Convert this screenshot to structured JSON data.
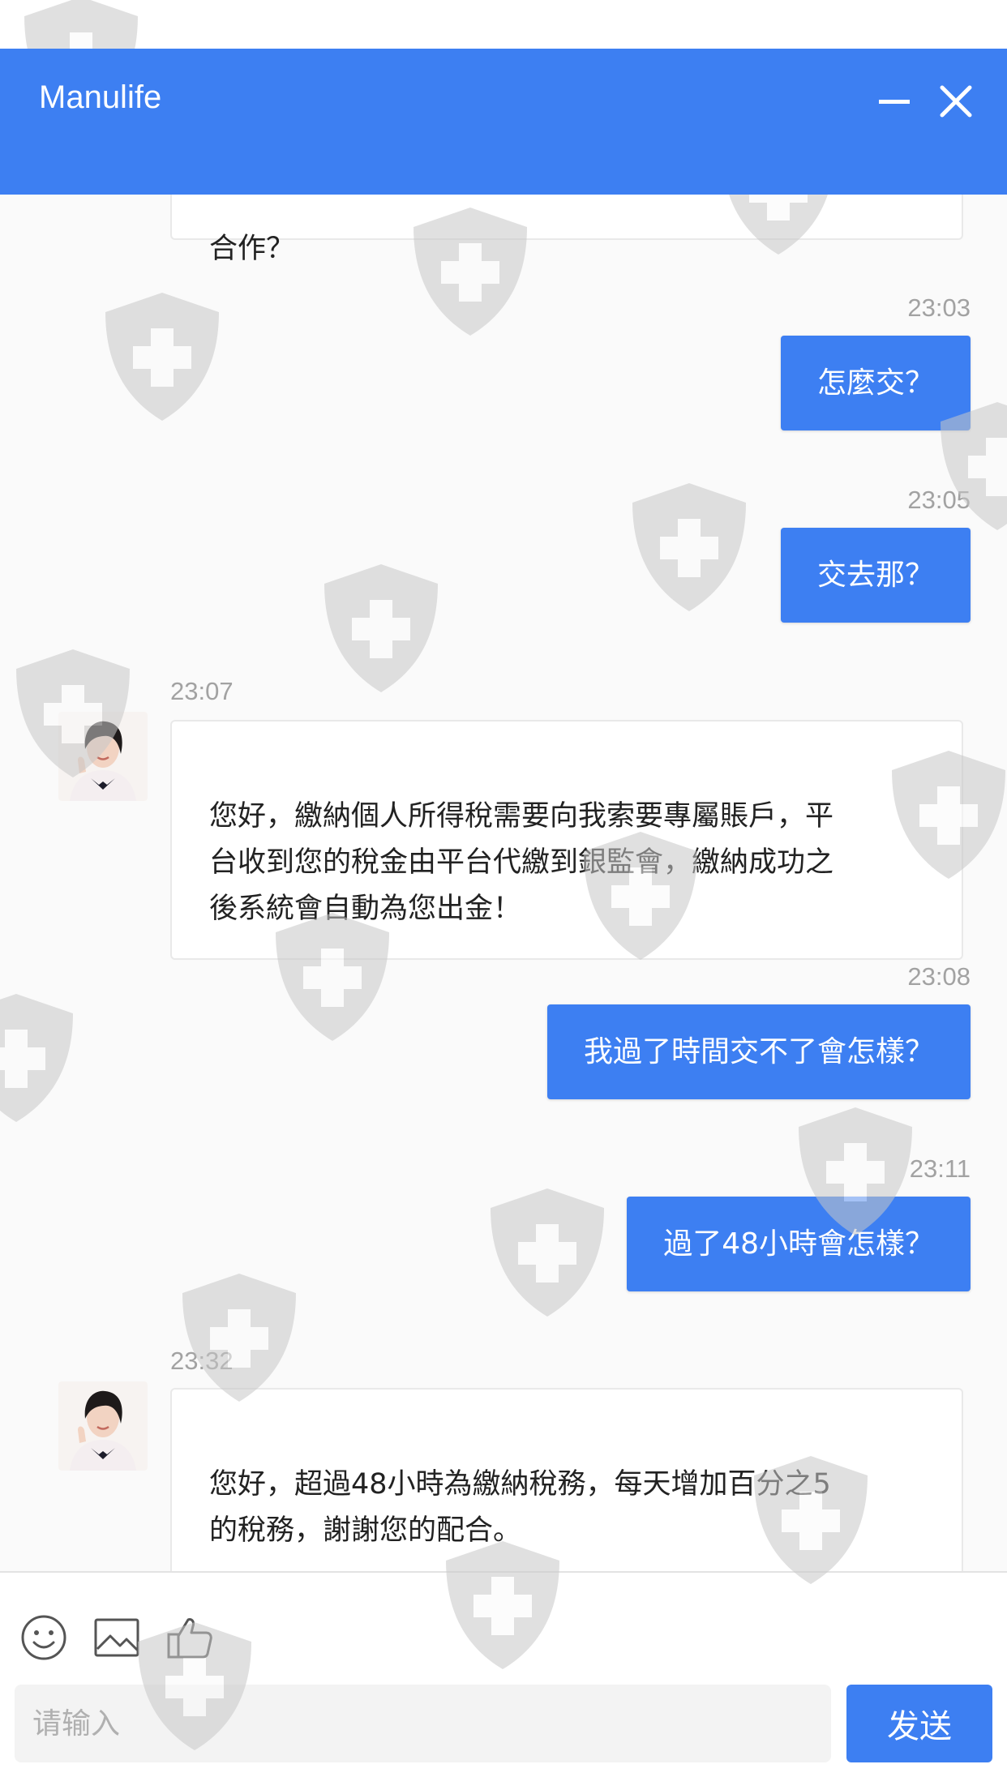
{
  "header": {
    "title": "Manulife",
    "background": "#3d7ff2"
  },
  "messages": [
    {
      "direction": "in",
      "partial_text": "合作？"
    },
    {
      "direction": "out",
      "time": "23:03",
      "text": "怎麼交？"
    },
    {
      "direction": "out",
      "time": "23:05",
      "text": "交去那？"
    },
    {
      "direction": "in",
      "time": "23:07",
      "text": "您好，繳納個人所得稅需要向我索要專屬賬戶，平\n台收到您的稅金由平台代繳到銀監會，繳納成功之\n後系統會自動為您出金！"
    },
    {
      "direction": "out",
      "time": "23:08",
      "text": "我過了時間交不了會怎樣？"
    },
    {
      "direction": "out",
      "time": "23:11",
      "text": "過了48小時會怎樣？"
    },
    {
      "direction": "in",
      "time": "23:32",
      "text": "您好，超過48小時為繳納稅務，每天增加百分之5\n的稅務，謝謝您的配合。"
    }
  ],
  "toolbar": {
    "icons": [
      "smiley-icon",
      "image-icon",
      "thumbs-up-icon"
    ]
  },
  "input": {
    "placeholder": "请输入",
    "value": ""
  },
  "send_button": {
    "label": "发送"
  },
  "colors": {
    "accent": "#3d7ff2",
    "chat_background": "#fafafa",
    "timestamp": "#a2a2a2",
    "watermark": "#c8c8c8"
  }
}
